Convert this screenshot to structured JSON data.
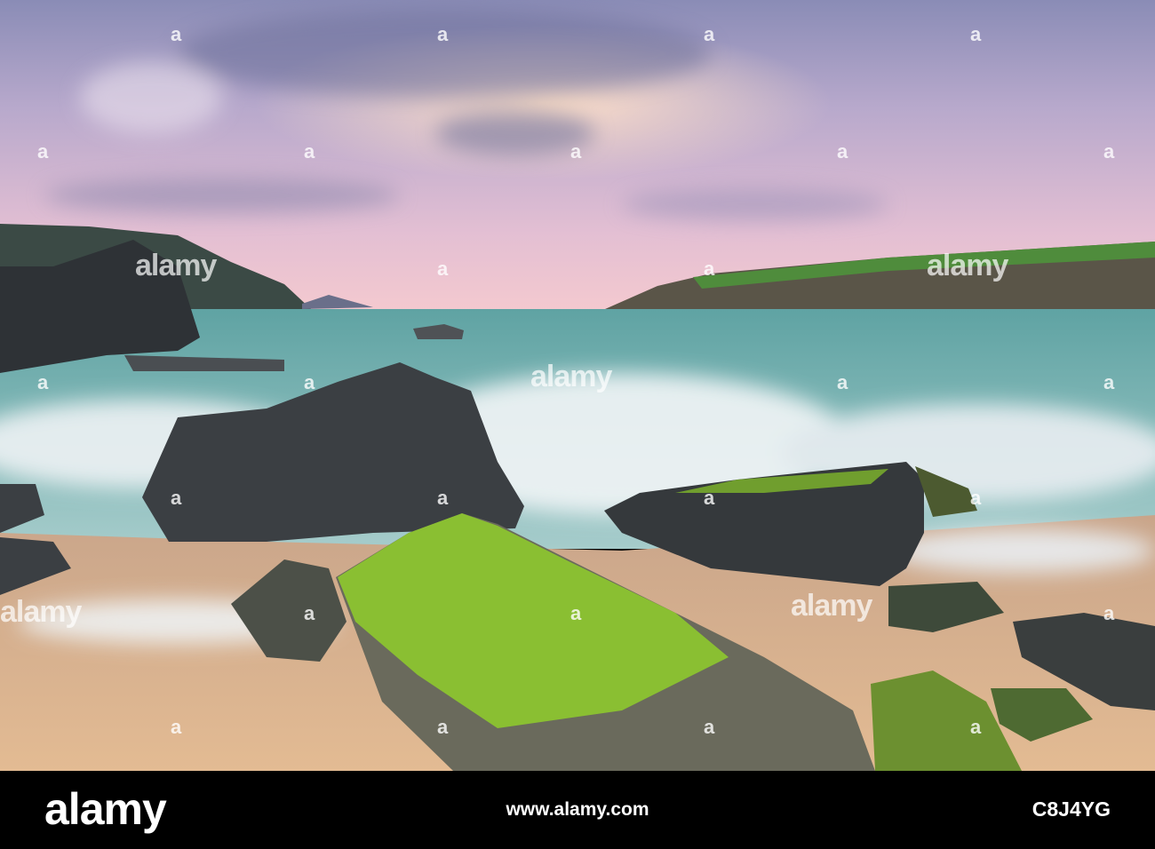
{
  "photo": {
    "subject": "coastal-seascape",
    "colors": {
      "sky_top": "#6f76a0",
      "sky_glow": "#f2c6cf",
      "sea": "#6fb4ad",
      "foam": "#e9eef2",
      "sand": "#d7b08e",
      "rock": "#3a3e42",
      "moss": "#8fce2a",
      "headland_grass": "#4e8a3a"
    }
  },
  "watermark": {
    "text": "alamy",
    "mark": "a"
  },
  "footer": {
    "logo": "alamy",
    "url": "www.alamy.com",
    "image_id": "C8J4YG"
  }
}
